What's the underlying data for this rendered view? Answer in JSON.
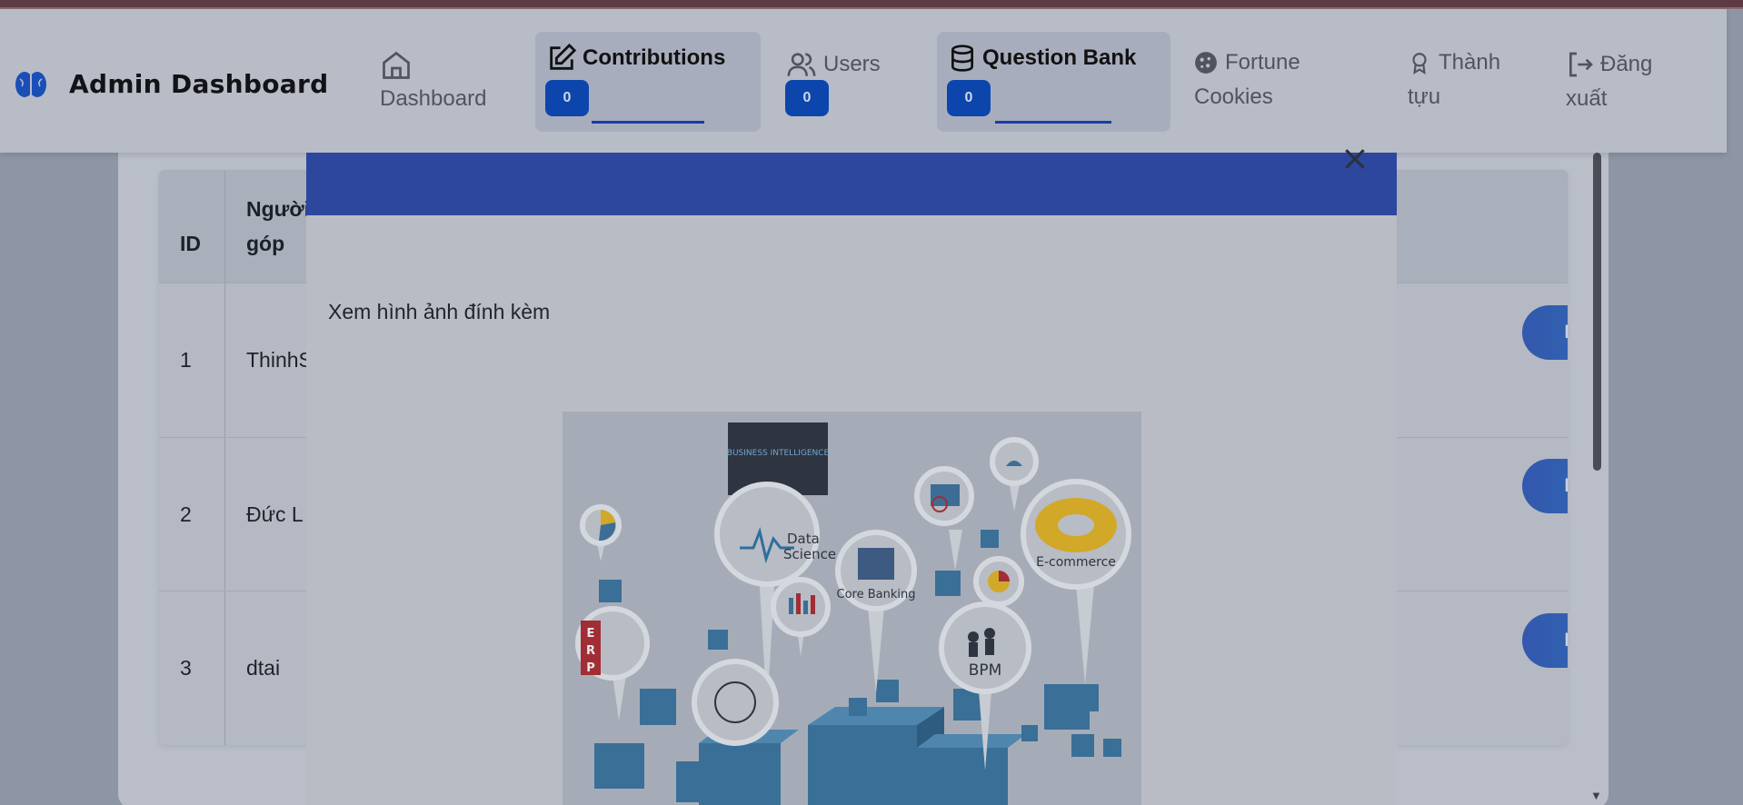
{
  "header": {
    "brand_title": "Admin Dashboard",
    "nav": {
      "dashboard": "Dashboard",
      "contributions": "Contributions",
      "contributions_count": "0",
      "users": "Users",
      "users_count": "0",
      "question_bank": "Question Bank",
      "question_bank_count": "0",
      "fortune_line1": "Fortune",
      "fortune_line2": "Cookies",
      "achievements_line1": "Thành",
      "achievements_line2": "tựu",
      "logout_line1": "Đăng",
      "logout_line2": "xuất"
    }
  },
  "table": {
    "headers": {
      "id": "ID",
      "contributor_line1": "Người",
      "contributor_line2": "góp"
    },
    "rows": [
      {
        "id": "1",
        "contributor": "ThinhS",
        "action": "Phê duyệt"
      },
      {
        "id": "2",
        "contributor": "Đức L",
        "action": "Phê duyệt"
      },
      {
        "id": "3",
        "contributor": "dtai",
        "action": "Phê duyệt"
      }
    ]
  },
  "modal": {
    "close": "×",
    "text": "Xem hình ảnh đính kèm",
    "attachment_labels": {
      "bi": "BUSINESS INTELLIGENCE",
      "data_science_1": "Data",
      "data_science_2": "Science",
      "core_banking": "Core Banking",
      "ecommerce": "E-commerce",
      "bpm": "BPM",
      "erp_e": "E",
      "erp_r": "R",
      "erp_p": "P"
    }
  },
  "colors": {
    "badge": "#0c46ad",
    "modal_header": "#2c479d",
    "approve_button": "#3358ad"
  }
}
